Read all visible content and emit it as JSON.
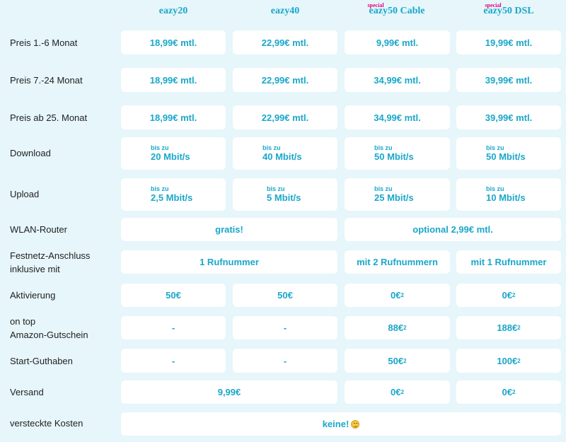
{
  "header": {
    "plans": [
      {
        "name": "eazy20",
        "special": ""
      },
      {
        "name": "eazy40",
        "special": ""
      },
      {
        "name": "eazy50 Cable",
        "special": "special"
      },
      {
        "name": "eazy50 DSL",
        "special": "special"
      }
    ]
  },
  "rows": {
    "preis1": {
      "label": "Preis 1.-6 Monat",
      "values": [
        "18,99€ mtl.",
        "22,99€ mtl.",
        "9,99€ mtl.",
        "19,99€ mtl."
      ]
    },
    "preis7": {
      "label": "Preis 7.-24 Monat",
      "values": [
        "18,99€ mtl.",
        "22,99€ mtl.",
        "34,99€ mtl.",
        "39,99€ mtl."
      ]
    },
    "preis25": {
      "label": "Preis ab 25. Monat",
      "values": [
        "18,99€ mtl.",
        "22,99€ mtl.",
        "34,99€ mtl.",
        "39,99€ mtl."
      ]
    },
    "download": {
      "label": "Download",
      "prefix": "bis zu",
      "values": [
        "20 Mbit/s",
        "40 Mbit/s",
        "50 Mbit/s",
        "50 Mbit/s"
      ]
    },
    "upload": {
      "label": "Upload",
      "prefix": "bis zu",
      "values": [
        "2,5 Mbit/s",
        "5 Mbit/s",
        "25 Mbit/s",
        "10 Mbit/s"
      ]
    },
    "router": {
      "label": "WLAN-Router",
      "values": [
        "gratis!",
        "optional 2,99€ mtl."
      ]
    },
    "festnetz": {
      "label_line1": "Festnetz-Anschluss",
      "label_line2": "inklusive mit",
      "values": [
        "1 Rufnummer",
        "mit 2 Rufnummern",
        "mit 1 Rufnummer"
      ]
    },
    "aktivierung": {
      "label": "Aktivierung",
      "values": [
        "50€",
        "50€",
        "0€",
        "0€"
      ],
      "footnote": "2"
    },
    "amazon": {
      "label_line1": "on top",
      "label_line2": "Amazon-Gutschein",
      "values": [
        "-",
        "-",
        "88€",
        "188€"
      ],
      "footnote": "2"
    },
    "guthaben": {
      "label": "Start-Guthaben",
      "values": [
        "-",
        "-",
        "50€",
        "100€"
      ],
      "footnote": "2"
    },
    "versand": {
      "label": "Versand",
      "values": [
        "9,99€",
        "0€",
        "0€"
      ],
      "footnote": "2"
    },
    "kosten": {
      "label": "versteckte Kosten",
      "value": "keine!",
      "icon": "smiley-icon"
    }
  },
  "colors": {
    "accent": "#1aa7c9",
    "special": "#e2007a",
    "background": "#e6f6fb"
  }
}
